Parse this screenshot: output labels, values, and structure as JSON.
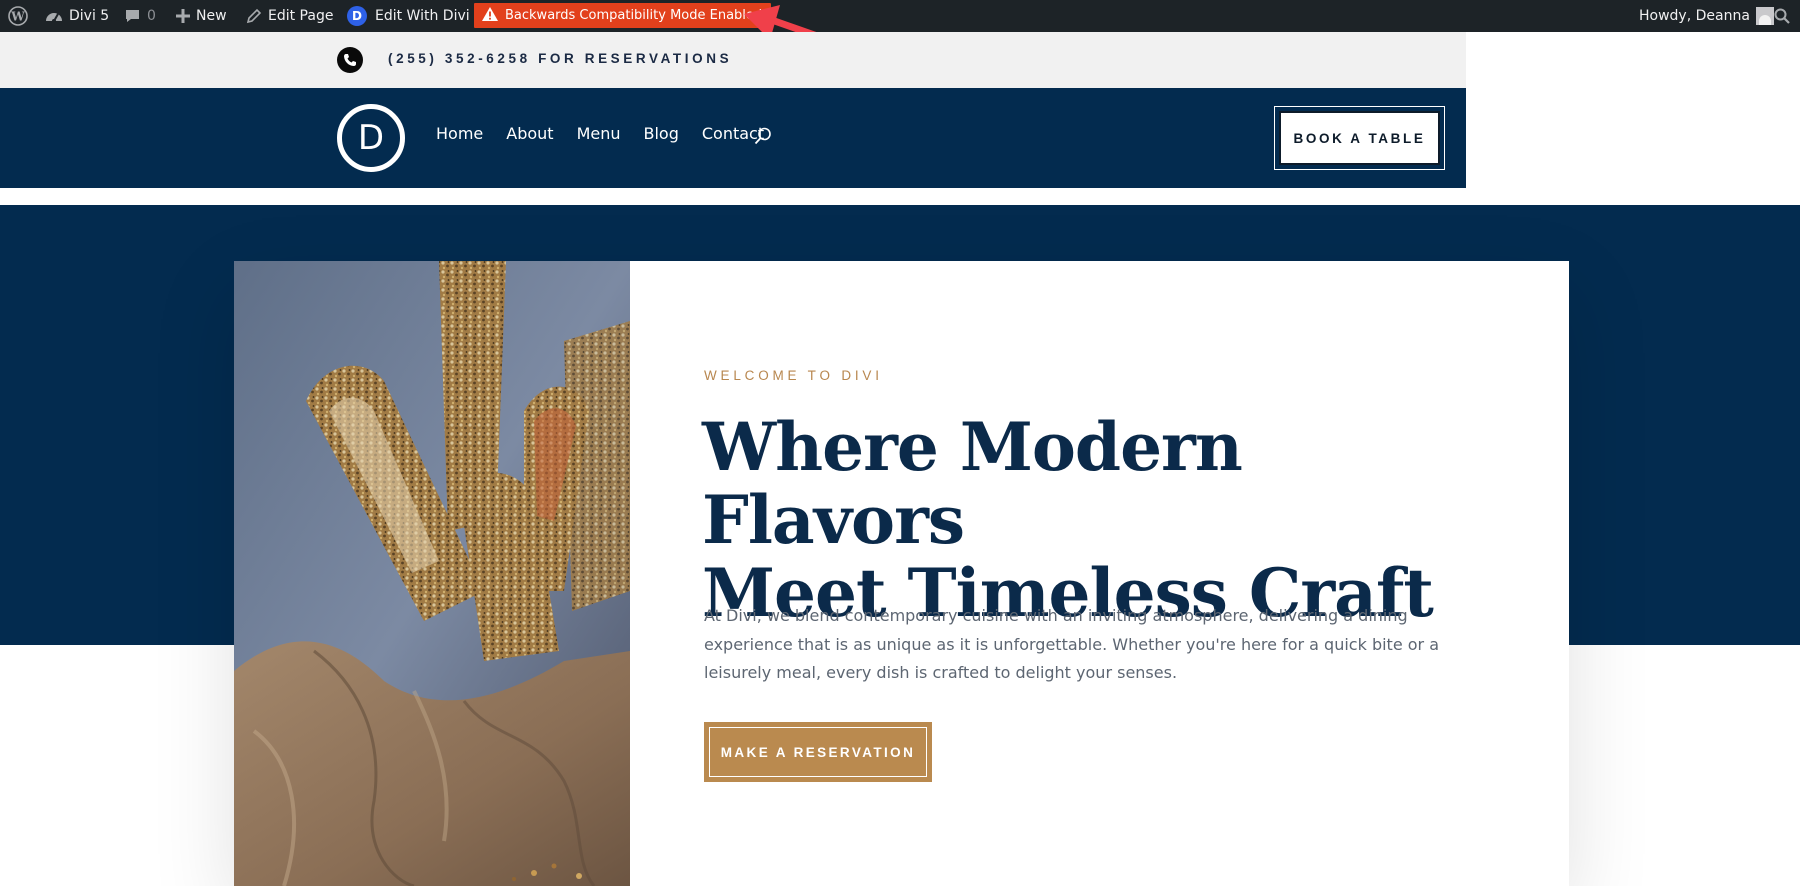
{
  "admin_bar": {
    "site_name": "Divi 5",
    "comments_count": "0",
    "new_label": "New",
    "edit_page_label": "Edit Page",
    "edit_with_divi_label": "Edit With Divi",
    "divi_badge": "D",
    "compat_notice": "Backwards Compatibility Mode Enabled",
    "greeting": "Howdy, Deanna",
    "icons": [
      "wordpress-icon",
      "dashboard-icon",
      "comment-icon",
      "plus-icon",
      "pencil-icon",
      "divi-icon",
      "warning-icon",
      "avatar",
      "search-icon"
    ],
    "colors": {
      "bar": "#1d2327",
      "notice": "#e2401c",
      "divi_badge": "#2e61e7"
    }
  },
  "annotation": {
    "color": "#f0404a"
  },
  "top_bar": {
    "phone_text": "(255) 352-6258 FOR RESERVATIONS"
  },
  "nav": {
    "logo_letter": "D",
    "links": [
      {
        "label": "Home"
      },
      {
        "label": "About"
      },
      {
        "label": "Menu"
      },
      {
        "label": "Blog"
      },
      {
        "label": "Contact"
      }
    ],
    "book_label": "BOOK A TABLE",
    "colors": {
      "background": "#032b4f"
    }
  },
  "hero": {
    "eyebrow": "WELCOME TO DIVI",
    "headline_line1": "Where Modern Flavors",
    "headline_line2": "Meet Timeless Craft",
    "body": "At Divi, we blend contemporary cuisine with an inviting atmosphere, delivering a dining experience that is as unique as it is unforgettable. Whether you're here for a quick bite or a leisurely meal, every dish is crafted to delight your senses.",
    "cta_label": "MAKE A RESERVATION",
    "colors": {
      "accent": "#ba8a4f",
      "headline": "#0b2a4a",
      "body": "#5d6672"
    }
  }
}
